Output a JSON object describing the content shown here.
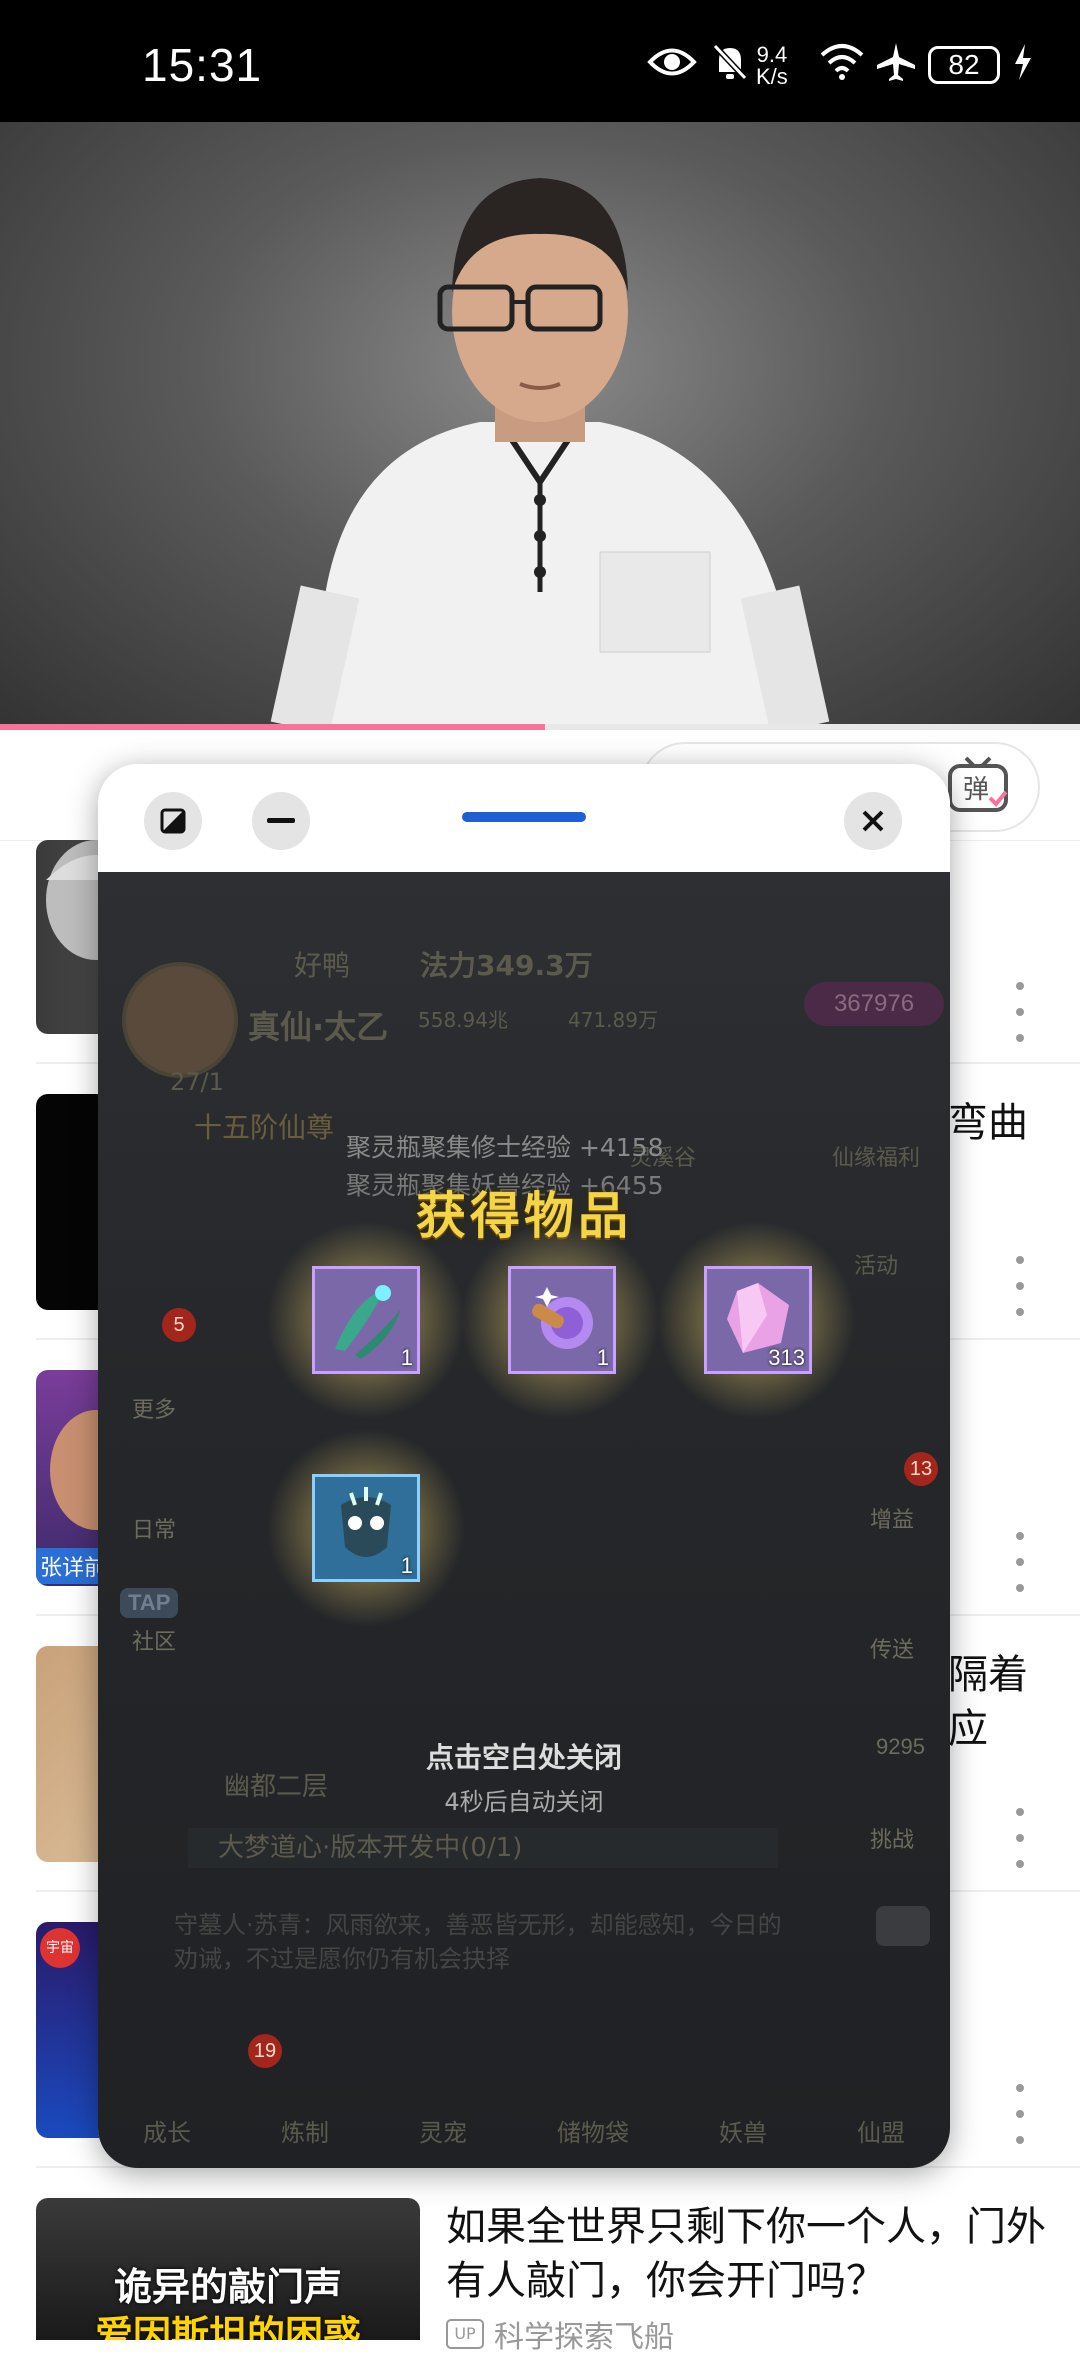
{
  "status_bar": {
    "time": "15:31",
    "net_speed_value": "9.4",
    "net_speed_unit": "K/s",
    "battery": "82",
    "icons": [
      "eye-icon",
      "bell-off-icon",
      "wifi-icon",
      "airplane-icon",
      "charging-icon"
    ]
  },
  "player": {
    "progress_fraction": 0.505,
    "accent": "#fb7299",
    "danmaku_label": "弹"
  },
  "feed": {
    "items": [
      {
        "title": "",
        "thumb": "einstein"
      },
      {
        "title": "弯曲",
        "thumb": "dark"
      },
      {
        "title": "",
        "thumb": "person",
        "thumb_text": "张详前"
      },
      {
        "title": "隔着\n应",
        "thumb": "room"
      },
      {
        "title": "",
        "thumb": "purple",
        "thumb_text": "宇宙"
      },
      {
        "title": "如果全世界只剩下你一个人，门外有人敲门，你会开门吗？",
        "thumb": "door",
        "thumb_text_1": "诡异的敲门声",
        "thumb_text_2": "爱因斯坦的困惑",
        "channel": "科学探索飞船"
      }
    ]
  },
  "floating_window": {
    "drag_color": "#1e5fd6",
    "game": {
      "player_name": "好鸭",
      "rank": "真仙·太乙",
      "power": "法力349.3万",
      "resource_1": "558.94兆",
      "resource_2": "471.89万",
      "gems": "367976",
      "level": "27/1",
      "title_badge": "十五阶仙尊",
      "exp_line_1": "聚灵瓶聚集修士经验  +4158",
      "exp_line_2": "聚灵瓶聚集妖兽经验  +6455",
      "popup_title": "获得物品",
      "items": [
        {
          "icon": "herb-icon",
          "count": "1",
          "color": "#7b68a8"
        },
        {
          "icon": "orb-icon",
          "count": "1",
          "color": "#7b68a8"
        },
        {
          "icon": "crystal-icon",
          "count": "313",
          "color": "#7b68a8"
        },
        {
          "icon": "mask-icon",
          "count": "1",
          "color": "#2f6f99"
        }
      ],
      "close_hint": "点击空白处关闭",
      "auto_close": "4秒后自动关闭",
      "left_menu": [
        "更多",
        "日常",
        "社区"
      ],
      "left_badge": "5",
      "right_menu": [
        "灵溪谷",
        "仙缘福利",
        "活动",
        "增益",
        "传送",
        "挑战"
      ],
      "right_badge": "13",
      "right_number": "9295",
      "location": "幽都二层",
      "quest": "大梦道心·版本开发中(0/1)",
      "story": "守墓人·苏青：风雨欲来，善恶皆无形，却能感知，今日的劝诫，不过是愿你仍有机会抉择",
      "bottom_tabs": [
        "成长",
        "炼制",
        "灵宠",
        "储物袋",
        "妖兽",
        "仙盟"
      ],
      "bottom_badge": "19",
      "tap_label": "TAP"
    }
  }
}
